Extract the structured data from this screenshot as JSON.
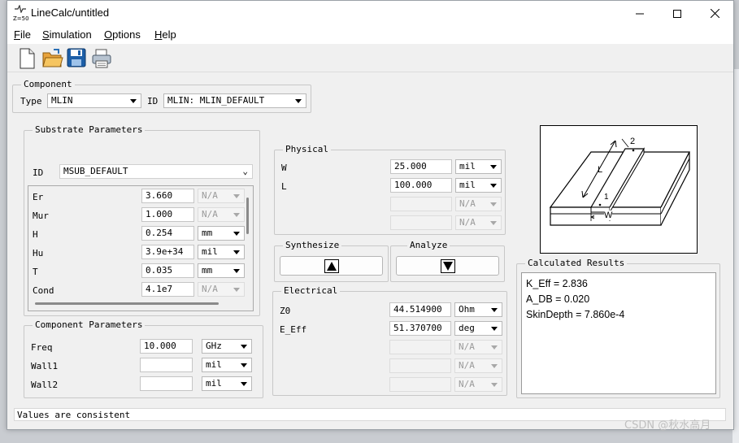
{
  "window": {
    "title": "LineCalc/untitled",
    "icon_text": "Z=50"
  },
  "menu": [
    {
      "pre": "",
      "key": "F",
      "rest": "ile"
    },
    {
      "pre": "",
      "key": "S",
      "rest": "imulation"
    },
    {
      "pre": "",
      "key": "O",
      "rest": "ptions"
    },
    {
      "pre": "",
      "key": "H",
      "rest": "elp"
    }
  ],
  "toolbar": {
    "new": "new-file-icon",
    "open": "open-folder-icon",
    "save": "save-disk-icon",
    "print": "printer-icon"
  },
  "component": {
    "title": "Component",
    "type_label": "Type",
    "type_value": "MLIN",
    "id_label": "ID",
    "id_value": "MLIN: MLIN_DEFAULT"
  },
  "substrate": {
    "title": "Substrate Parameters",
    "id_label": "ID",
    "id_value": "MSUB_DEFAULT",
    "rows": [
      {
        "name": "Er",
        "value": "3.660",
        "unit": "N/A"
      },
      {
        "name": "Mur",
        "value": "1.000",
        "unit": "N/A"
      },
      {
        "name": "H",
        "value": "0.254",
        "unit": "mm"
      },
      {
        "name": "Hu",
        "value": "3.9e+34",
        "unit": "mil"
      },
      {
        "name": "T",
        "value": "0.035",
        "unit": "mm"
      },
      {
        "name": "Cond",
        "value": "4.1e7",
        "unit": "N/A"
      }
    ]
  },
  "component_params": {
    "title": "Component Parameters",
    "rows": [
      {
        "name": "Freq",
        "value": "10.000",
        "unit": "GHz"
      },
      {
        "name": "Wall1",
        "value": "",
        "unit": "mil"
      },
      {
        "name": "Wall2",
        "value": "",
        "unit": "mil"
      }
    ]
  },
  "physical": {
    "title": "Physical",
    "rows": [
      {
        "name": "W",
        "value": "25.000",
        "unit": "mil"
      },
      {
        "name": "L",
        "value": "100.000",
        "unit": "mil"
      },
      {
        "name": "",
        "value": "",
        "unit": "N/A"
      },
      {
        "name": "",
        "value": "",
        "unit": "N/A"
      }
    ]
  },
  "synthesize": {
    "title": "Synthesize",
    "icon": "arrow-up-icon"
  },
  "analyze": {
    "title": "Analyze",
    "icon": "arrow-down-icon"
  },
  "electrical": {
    "title": "Electrical",
    "rows": [
      {
        "name": "Z0",
        "value": "44.514900",
        "unit": "Ohm"
      },
      {
        "name": "E_Eff",
        "value": "51.370700",
        "unit": "deg"
      },
      {
        "name": "",
        "value": "",
        "unit": "N/A"
      },
      {
        "name": "",
        "value": "",
        "unit": "N/A"
      },
      {
        "name": "",
        "value": "",
        "unit": "N/A"
      }
    ]
  },
  "diagram": {
    "port1": "1",
    "port2": "2",
    "length": "L",
    "width": "W"
  },
  "results": {
    "title": "Calculated Results",
    "lines": [
      "K_Eff = 2.836",
      "A_DB = 0.020",
      "SkinDepth = 7.860e-4"
    ]
  },
  "status": {
    "text": "Values are consistent"
  },
  "watermark": "CSDN @秋水高月"
}
